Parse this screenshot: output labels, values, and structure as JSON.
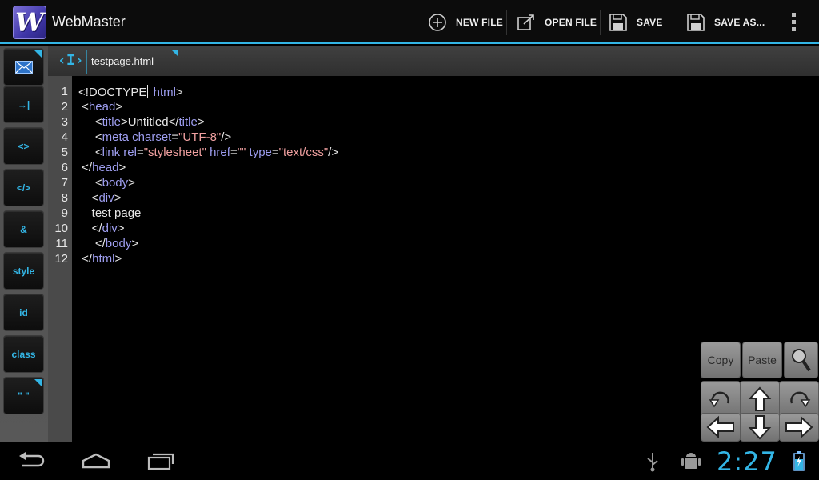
{
  "app": {
    "title": "WebMaster",
    "icon_letter": "W"
  },
  "actions": [
    {
      "label": "NEW FILE",
      "icon": "plus-circle-icon"
    },
    {
      "label": "OPEN FILE",
      "icon": "open-file-icon"
    },
    {
      "label": "SAVE",
      "icon": "floppy-icon"
    },
    {
      "label": "SAVE AS...",
      "icon": "floppy-icon"
    }
  ],
  "toolstrip": {
    "buttons": [
      "→|",
      "<>",
      "</>",
      "&",
      "style",
      "id",
      "class",
      "\" \""
    ]
  },
  "tab": {
    "label": "testpage.html"
  },
  "editor": {
    "line_numbers": [
      "1",
      "2",
      "3",
      "4",
      "5",
      "6",
      "7",
      "8",
      "9",
      "10",
      "11",
      "12"
    ],
    "lines": [
      "<!DOCTYPE html>",
      " <head>",
      "     <title>Untitled</title>",
      "     <meta charset=\"UTF-8\"/>",
      "     <link rel=\"stylesheet\" href=\"\" type=\"text/css\"/>",
      " </head>",
      "     <body>",
      "    <div>",
      "    test page",
      "    </div>",
      "     </body>",
      " </html>"
    ]
  },
  "keypad": {
    "copy": "Copy",
    "paste": "Paste"
  },
  "statusbar": {
    "clock": "2:27"
  },
  "colors": {
    "accent": "#33b5e5",
    "tag": "#9e9ef0",
    "string": "#f0a0a0"
  }
}
